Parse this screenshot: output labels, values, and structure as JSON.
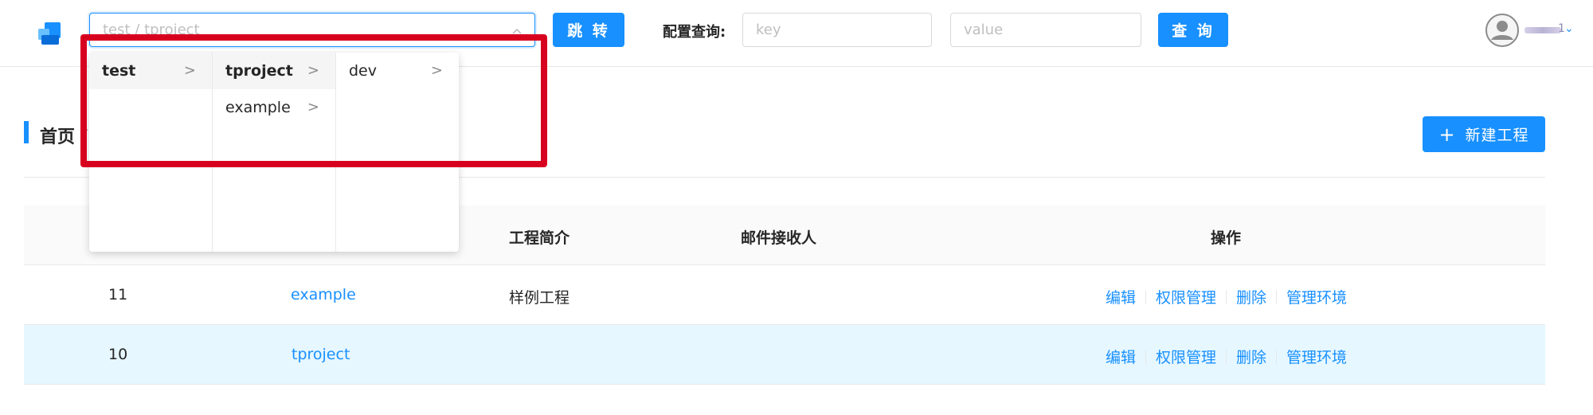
{
  "header": {
    "project_path_placeholder": "test / tproject",
    "jump_button": "跳 转",
    "config_query_label": "配置查询:",
    "key_placeholder": "key",
    "value_placeholder": "value",
    "query_button": "查 询",
    "user_suffix": "1"
  },
  "cascader": {
    "columns": [
      [
        {
          "label": "test",
          "active": true
        }
      ],
      [
        {
          "label": "tproject",
          "active": true
        },
        {
          "label": "example",
          "active": false
        }
      ],
      [
        {
          "label": "dev",
          "active": false
        }
      ]
    ],
    "chevron": ">"
  },
  "page": {
    "breadcrumb": "首页 /",
    "new_project_plus": "+",
    "new_project_button": "新建工程"
  },
  "table": {
    "headers": {
      "intro": "工程简介",
      "recipients": "邮件接收人",
      "actions": "操作"
    },
    "rows": [
      {
        "id": "11",
        "name": "example",
        "intro": "样例工程",
        "recipients": ""
      },
      {
        "id": "10",
        "name": "tproject",
        "intro": "",
        "recipients": ""
      }
    ],
    "actions": {
      "edit": "编辑",
      "permissions": "权限管理",
      "delete": "删除",
      "manage_env": "管理环境"
    }
  },
  "colors": {
    "primary": "#1890ff",
    "highlight": "#d7001f",
    "selected_row": "#e6f7ff"
  },
  "icons": {
    "logo": "app-logo-icon",
    "arrow": "chevron-up-icon",
    "avatar": "user-avatar-icon"
  }
}
